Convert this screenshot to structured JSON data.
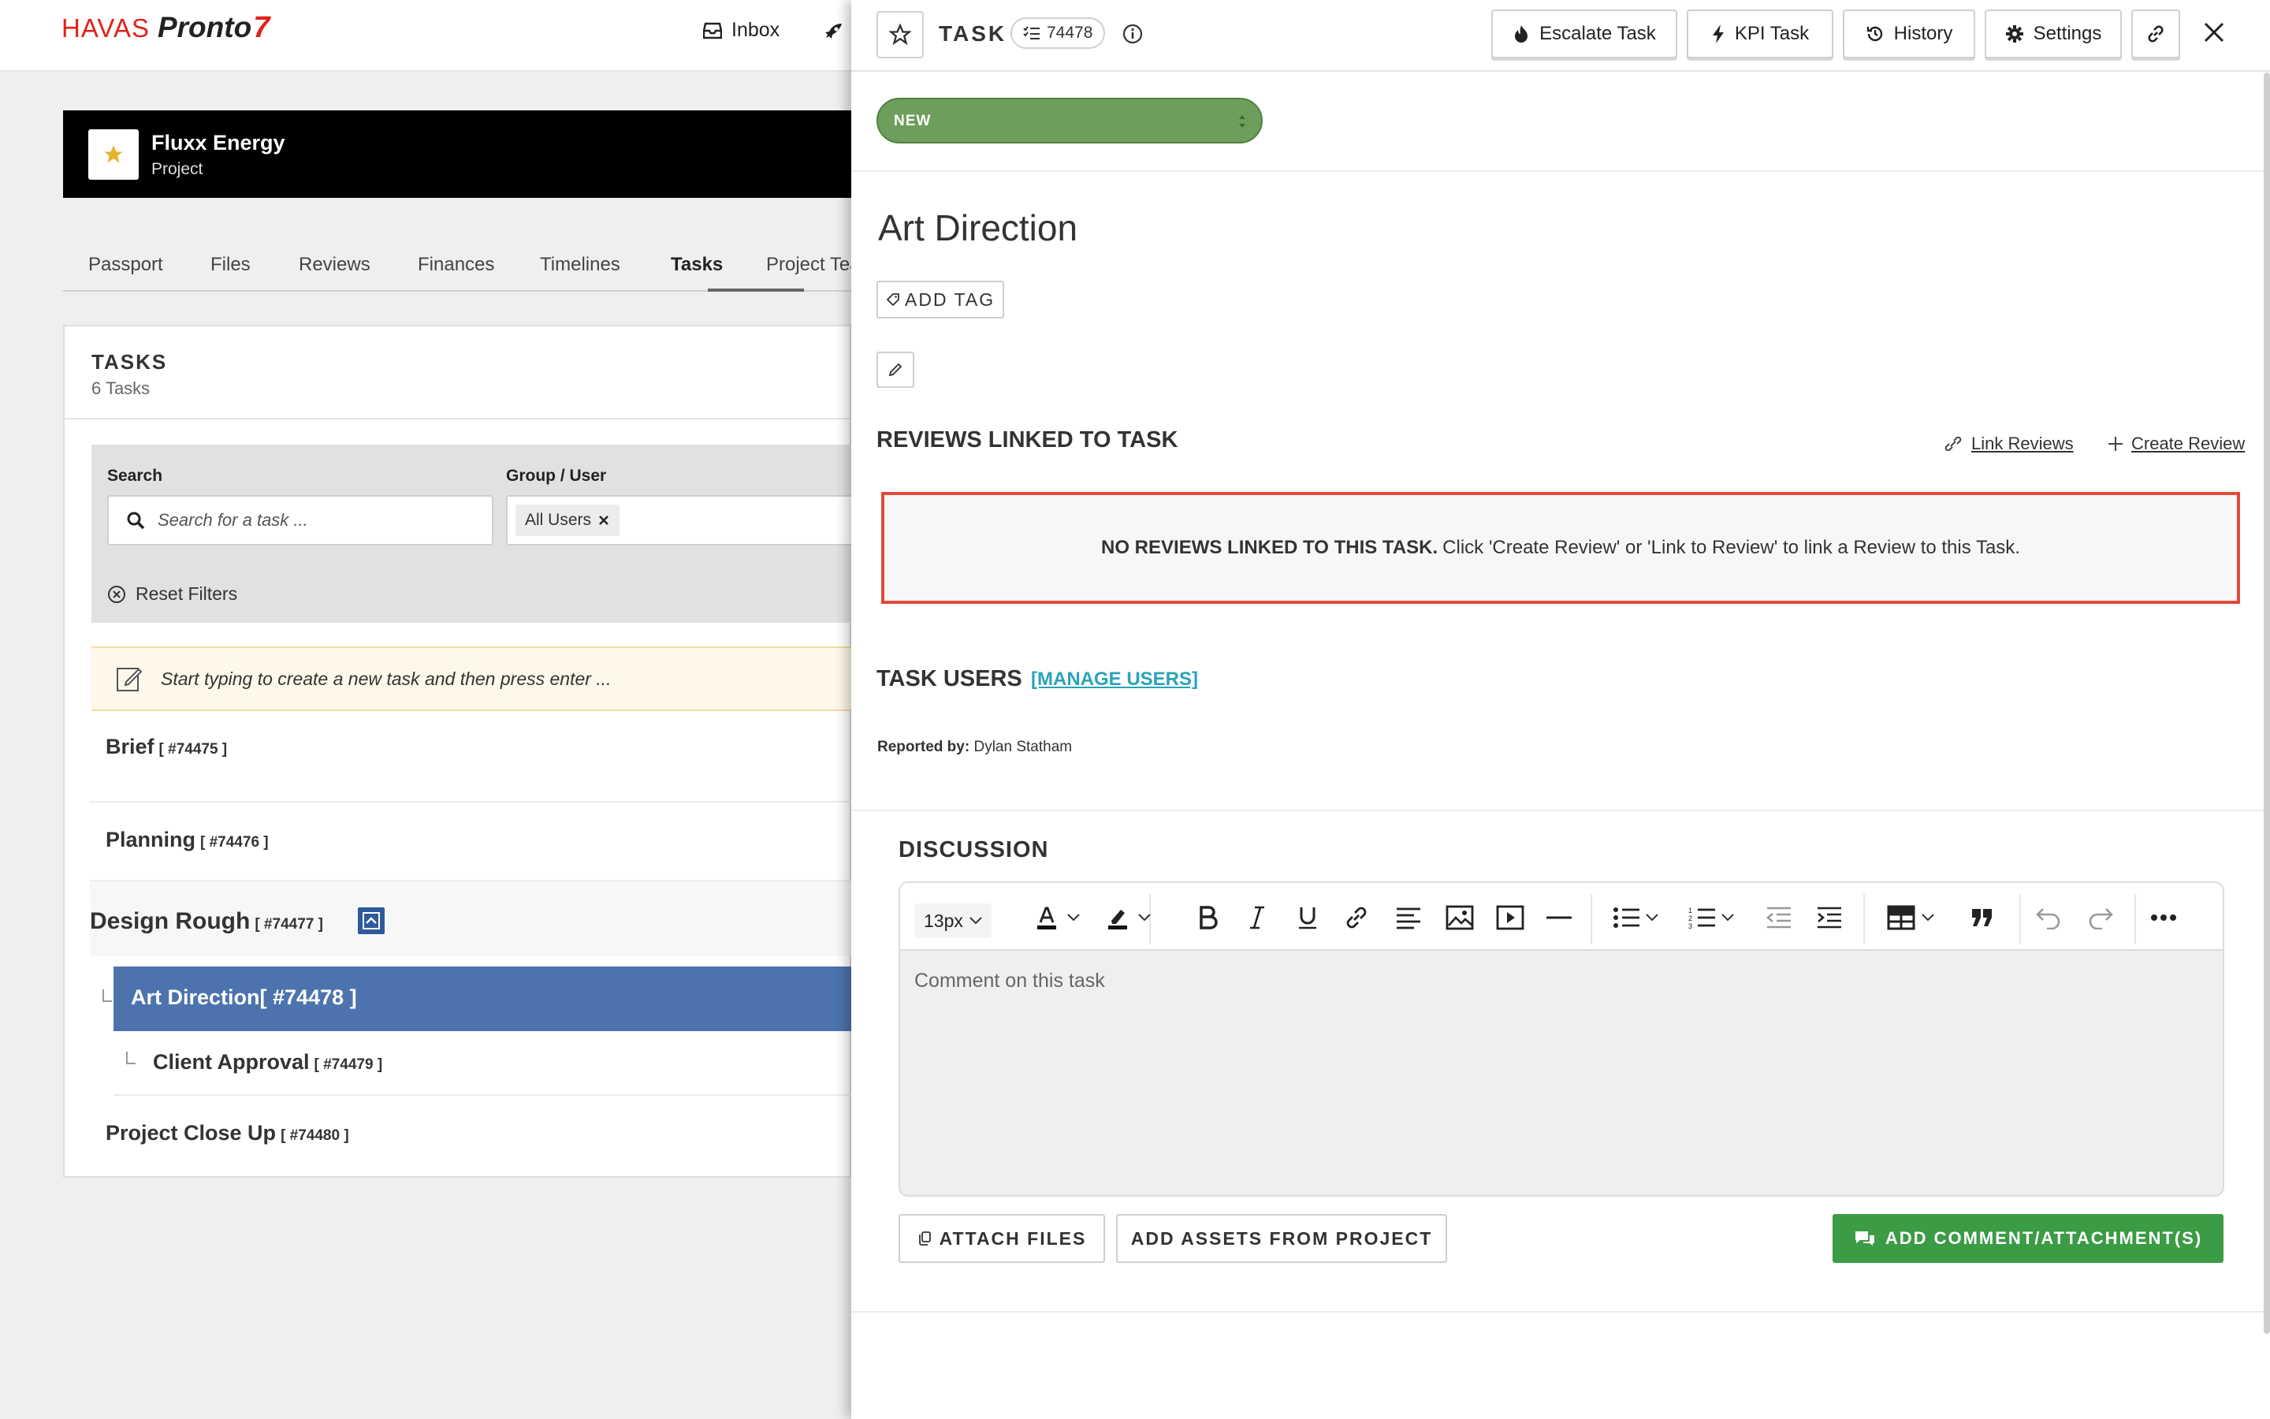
{
  "app": {
    "logo_brand": "HAVAS",
    "logo_product": "Pronto",
    "logo_mark": "7",
    "nav": {
      "inbox_label": "Inbox"
    }
  },
  "project": {
    "name": "Fluxx Energy",
    "type": "Project",
    "tabs": [
      "Passport",
      "Files",
      "Reviews",
      "Finances",
      "Timelines",
      "Tasks",
      "Project Tea"
    ],
    "active_tab": "Tasks"
  },
  "tasks_panel": {
    "title": "TASKS",
    "count": "6 Tasks",
    "filters": {
      "search_label": "Search",
      "search_placeholder": "Search for a task ...",
      "group_label": "Group / User",
      "group_chip": "All Users",
      "reset_label": "Reset Filters"
    },
    "new_task_prompt": "Start typing to create a new task and then press enter ...",
    "rows": [
      {
        "name": "Brief",
        "id": "[ #74475 ]"
      },
      {
        "name": "Planning",
        "id": "[ #74476 ]"
      },
      {
        "name": "Design Rough",
        "id": "[ #74477 ]"
      },
      {
        "name": "Art Direction",
        "id": "[ #74478 ]"
      },
      {
        "name": "Client Approval",
        "id": "[ #74479 ]"
      },
      {
        "name": "Project Close Up",
        "id": "[ #74480 ]"
      }
    ]
  },
  "drawer": {
    "header": {
      "label": "TASK",
      "task_id": "74478",
      "buttons": {
        "escalate": "Escalate Task",
        "kpi": "KPI Task",
        "history": "History",
        "settings": "Settings"
      }
    },
    "status": "NEW",
    "task_title": "Art Direction",
    "add_tag_label": "ADD TAG",
    "reviews": {
      "heading": "REVIEWS LINKED TO TASK",
      "link_reviews": "Link Reviews",
      "create_review": "Create Review",
      "empty_strong": "NO REVIEWS LINKED TO THIS TASK.",
      "empty_text": "Click 'Create Review' or 'Link to Review' to link a Review to this Task."
    },
    "users": {
      "heading": "TASK USERS",
      "manage": "[MANAGE USERS]",
      "reported_label": "Reported by:",
      "reported_name": "Dylan Statham"
    },
    "discussion": {
      "heading": "DISCUSSION",
      "font_size": "13px",
      "placeholder": "Comment on this task",
      "attach_label": "ATTACH FILES",
      "assets_label": "ADD ASSETS FROM PROJECT",
      "submit_label": "ADD COMMENT/ATTACHMENT(S)"
    }
  },
  "colors": {
    "brand_red": "#e2231a",
    "status_green": "#6d9e5c",
    "selected_row": "#4d73ae",
    "submit_green": "#3c9b45",
    "alert_border": "#e04b3a",
    "link_teal": "#2aa3b9"
  }
}
